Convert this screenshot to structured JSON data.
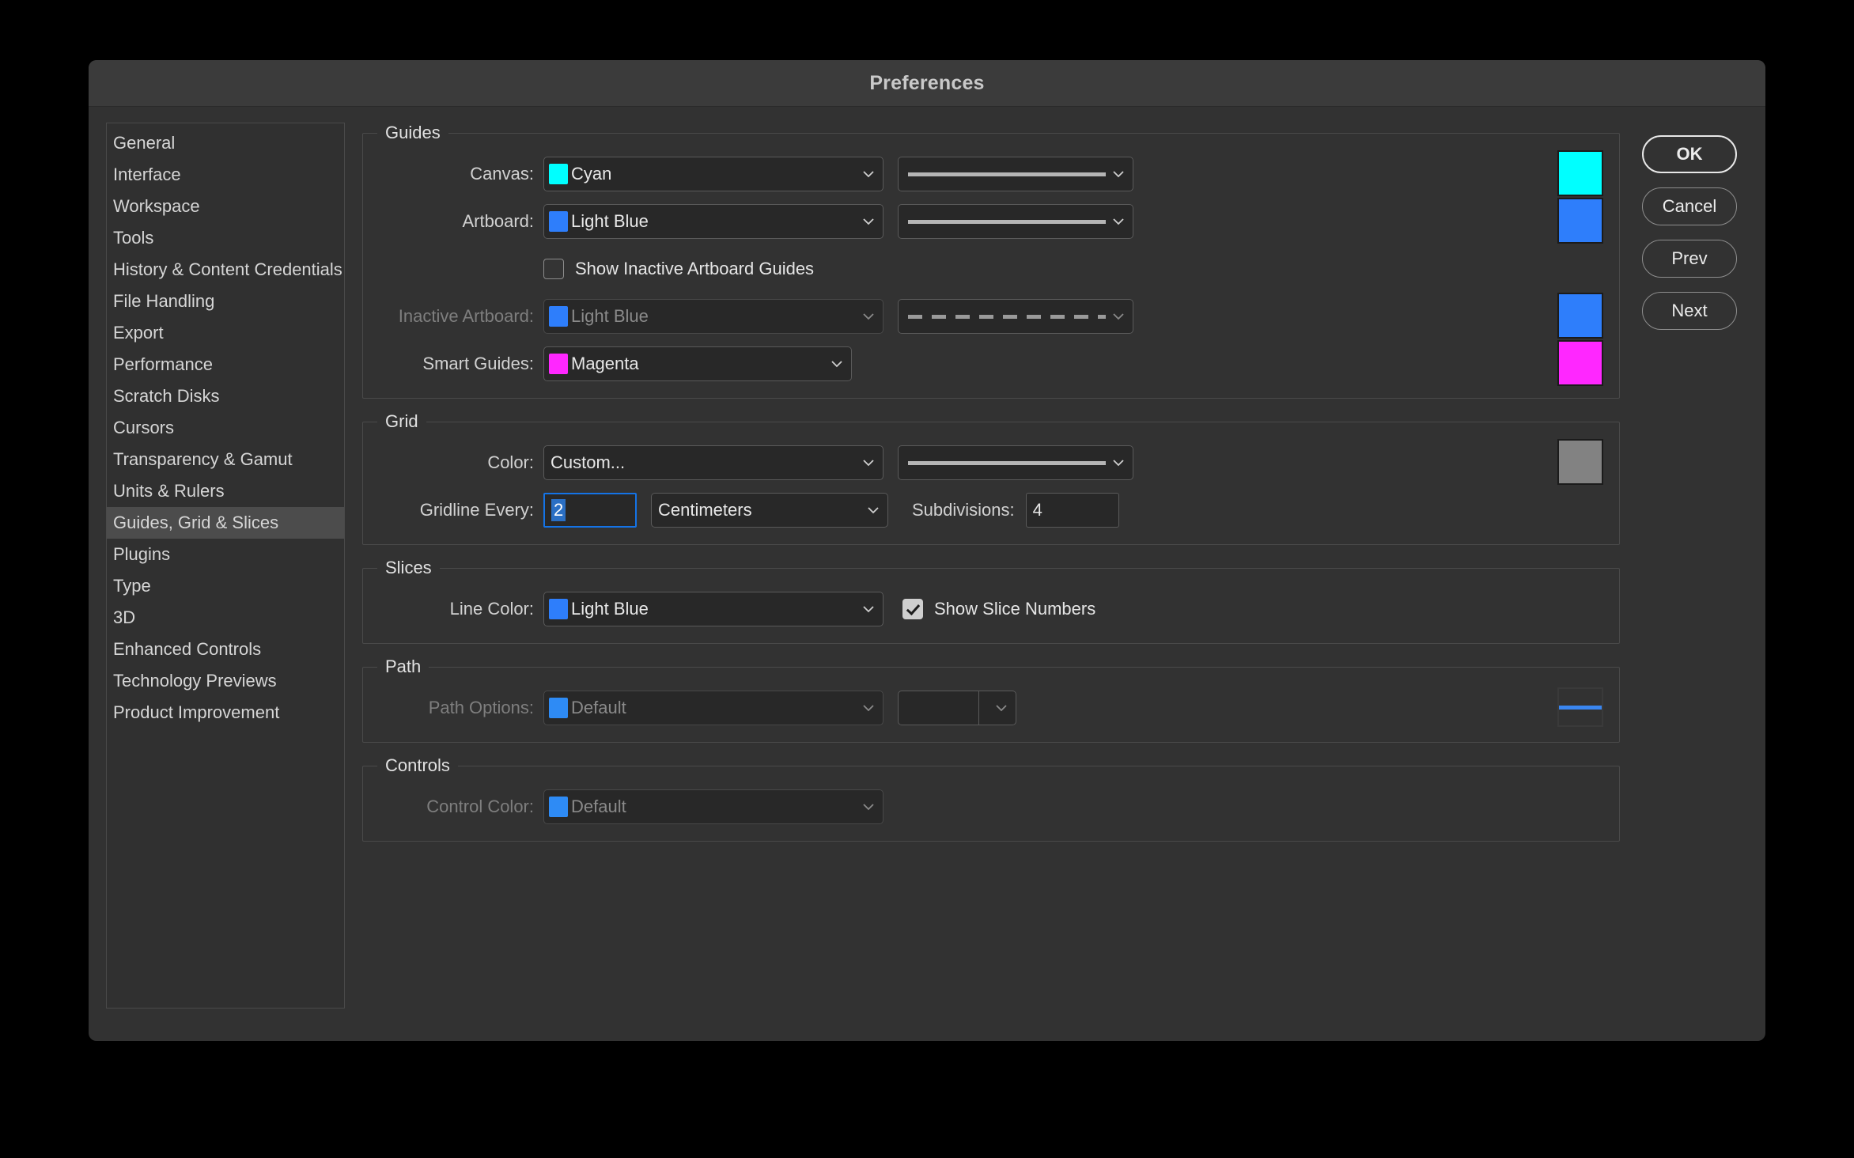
{
  "dialog": {
    "title": "Preferences"
  },
  "sidebar": {
    "items": [
      {
        "label": "General",
        "selected": false
      },
      {
        "label": "Interface",
        "selected": false
      },
      {
        "label": "Workspace",
        "selected": false
      },
      {
        "label": "Tools",
        "selected": false
      },
      {
        "label": "History & Content Credentials",
        "selected": false
      },
      {
        "label": "File Handling",
        "selected": false
      },
      {
        "label": "Export",
        "selected": false
      },
      {
        "label": "Performance",
        "selected": false
      },
      {
        "label": "Scratch Disks",
        "selected": false
      },
      {
        "label": "Cursors",
        "selected": false
      },
      {
        "label": "Transparency & Gamut",
        "selected": false
      },
      {
        "label": "Units & Rulers",
        "selected": false
      },
      {
        "label": "Guides, Grid & Slices",
        "selected": true
      },
      {
        "label": "Plugins",
        "selected": false
      },
      {
        "label": "Type",
        "selected": false
      },
      {
        "label": "3D",
        "selected": false
      },
      {
        "label": "Enhanced Controls",
        "selected": false
      },
      {
        "label": "Technology Previews",
        "selected": false
      },
      {
        "label": "Product Improvement",
        "selected": false
      }
    ]
  },
  "guides": {
    "legend": "Guides",
    "canvas": {
      "label": "Canvas:",
      "color_name": "Cyan",
      "color_hex": "#00FFFF",
      "line_style": "solid"
    },
    "artboard": {
      "label": "Artboard:",
      "color_name": "Light Blue",
      "color_hex": "#2E7EFB",
      "line_style": "solid"
    },
    "show_inactive_checkbox": {
      "label": "Show Inactive Artboard Guides",
      "checked": false
    },
    "inactive_artboard": {
      "label": "Inactive Artboard:",
      "color_name": "Light Blue",
      "color_hex": "#2E7EFB",
      "line_style": "dashed",
      "disabled": true
    },
    "smart_guides": {
      "label": "Smart Guides:",
      "color_name": "Magenta",
      "color_hex": "#FF27FF"
    }
  },
  "grid": {
    "legend": "Grid",
    "color": {
      "label": "Color:",
      "value": "Custom...",
      "swatch_hex": "#828282",
      "line_style": "solid"
    },
    "gridline_every": {
      "label": "Gridline Every:",
      "value": "2",
      "selected": true
    },
    "unit": {
      "value": "Centimeters"
    },
    "subdivisions": {
      "label": "Subdivisions:",
      "value": "4"
    }
  },
  "slices": {
    "legend": "Slices",
    "line_color": {
      "label": "Line Color:",
      "color_name": "Light Blue",
      "color_hex": "#2E7EFB"
    },
    "show_slice_numbers": {
      "label": "Show Slice Numbers",
      "checked": true
    }
  },
  "path": {
    "legend": "Path",
    "path_options": {
      "label": "Path Options:",
      "color_name": "Default",
      "color_hex": "#2E8BF5",
      "disabled": true
    },
    "preview_line_hex": "#3A86F0"
  },
  "controls": {
    "legend": "Controls",
    "control_color": {
      "label": "Control Color:",
      "color_name": "Default",
      "color_hex": "#2E8BF5",
      "disabled": true
    }
  },
  "buttons": {
    "ok": "OK",
    "cancel": "Cancel",
    "prev": "Prev",
    "next": "Next"
  }
}
